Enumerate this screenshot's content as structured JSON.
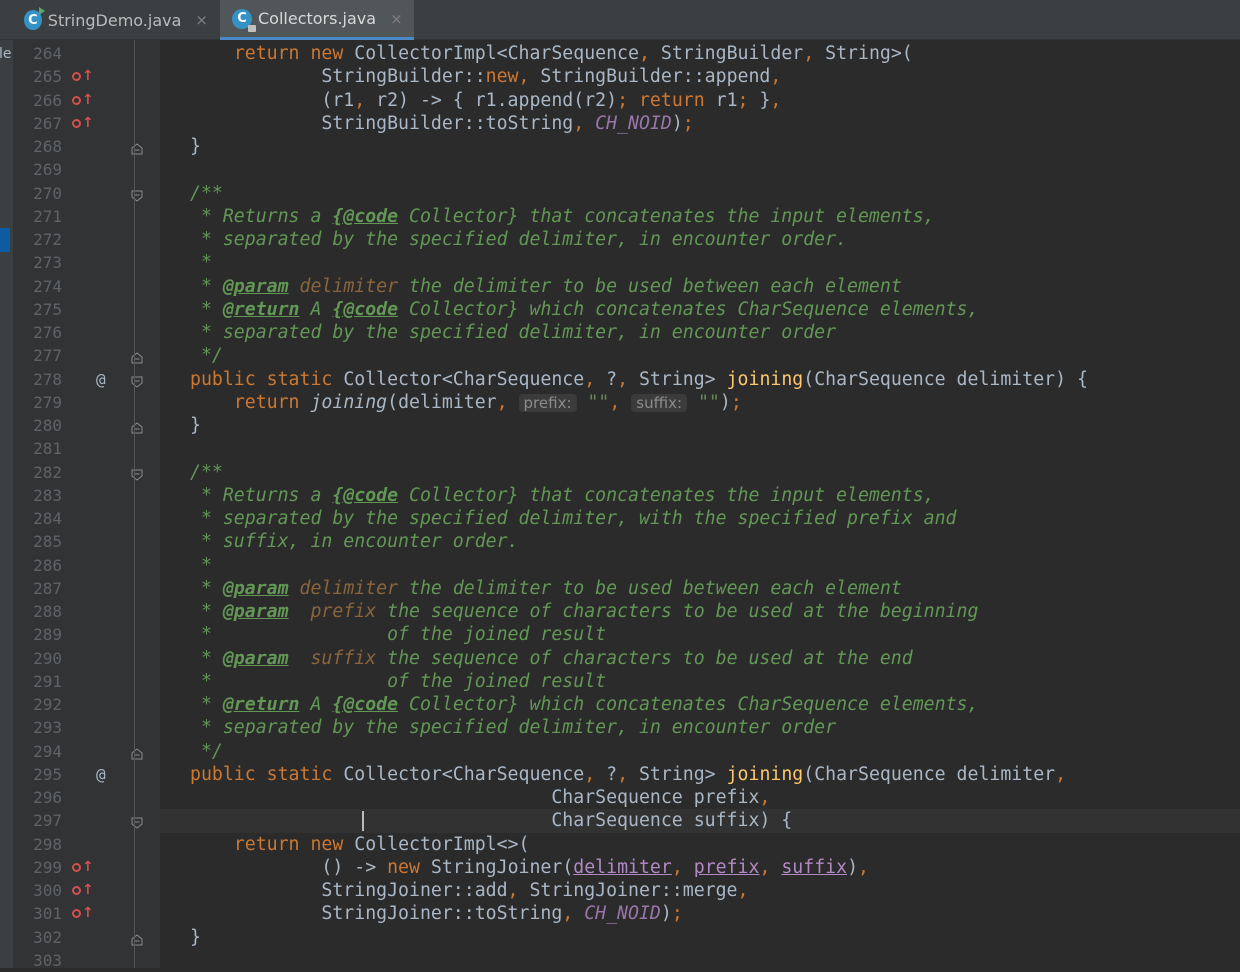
{
  "tabs": [
    {
      "label": "StringDemo.java",
      "icon_letter": "C"
    },
    {
      "label": "Collectors.java",
      "icon_letter": "C"
    }
  ],
  "side_strip_text": "le",
  "current_line": 297,
  "hints": {
    "prefix": "prefix:",
    "suffix": "suffix:"
  },
  "lines": [
    {
      "n": "264",
      "gutter": ""
    },
    {
      "n": "265",
      "gutter": "override"
    },
    {
      "n": "266",
      "gutter": "override"
    },
    {
      "n": "267",
      "gutter": "override"
    },
    {
      "n": "268",
      "gutter": "fold-end"
    },
    {
      "n": "269",
      "gutter": ""
    },
    {
      "n": "270",
      "gutter": "fold-start"
    },
    {
      "n": "271",
      "gutter": ""
    },
    {
      "n": "272",
      "gutter": ""
    },
    {
      "n": "273",
      "gutter": ""
    },
    {
      "n": "274",
      "gutter": ""
    },
    {
      "n": "275",
      "gutter": ""
    },
    {
      "n": "276",
      "gutter": ""
    },
    {
      "n": "277",
      "gutter": "fold-end"
    },
    {
      "n": "278",
      "gutter": "at-fold"
    },
    {
      "n": "279",
      "gutter": ""
    },
    {
      "n": "280",
      "gutter": "fold-end"
    },
    {
      "n": "281",
      "gutter": ""
    },
    {
      "n": "282",
      "gutter": "fold-start"
    },
    {
      "n": "283",
      "gutter": ""
    },
    {
      "n": "284",
      "gutter": ""
    },
    {
      "n": "285",
      "gutter": ""
    },
    {
      "n": "286",
      "gutter": ""
    },
    {
      "n": "287",
      "gutter": ""
    },
    {
      "n": "288",
      "gutter": ""
    },
    {
      "n": "289",
      "gutter": ""
    },
    {
      "n": "290",
      "gutter": ""
    },
    {
      "n": "291",
      "gutter": ""
    },
    {
      "n": "292",
      "gutter": ""
    },
    {
      "n": "293",
      "gutter": ""
    },
    {
      "n": "294",
      "gutter": "fold-end"
    },
    {
      "n": "295",
      "gutter": "at"
    },
    {
      "n": "296",
      "gutter": ""
    },
    {
      "n": "297",
      "gutter": "fold-start"
    },
    {
      "n": "298",
      "gutter": ""
    },
    {
      "n": "299",
      "gutter": "override"
    },
    {
      "n": "300",
      "gutter": "override"
    },
    {
      "n": "301",
      "gutter": "override"
    },
    {
      "n": "302",
      "gutter": "fold-end"
    },
    {
      "n": "303",
      "gutter": ""
    }
  ],
  "code": [
    [
      [
        "    ",
        ""
      ],
      [
        "return new ",
        "kw"
      ],
      [
        "CollectorImpl<CharSequence",
        ""
      ],
      [
        ", ",
        "kw"
      ],
      [
        "StringBuilder",
        ""
      ],
      [
        ", ",
        "kw"
      ],
      [
        "String>(",
        ""
      ]
    ],
    [
      [
        "            StringBuilder::",
        ""
      ],
      [
        "new",
        "kw"
      ],
      [
        ", ",
        "kw"
      ],
      [
        "StringBuilder::append",
        ""
      ],
      [
        ",",
        "kw"
      ]
    ],
    [
      [
        "            (r1",
        ""
      ],
      [
        ", ",
        "kw"
      ],
      [
        "r2) -> { r1.append(r2)",
        ""
      ],
      [
        "; ",
        "kw"
      ],
      [
        "return ",
        "kw"
      ],
      [
        "r1",
        ""
      ],
      [
        "; ",
        "kw"
      ],
      [
        "}",
        ""
      ],
      [
        ",",
        "kw"
      ]
    ],
    [
      [
        "            StringBuilder::toString",
        ""
      ],
      [
        ", ",
        "kw"
      ],
      [
        "CH_NOID",
        "cst"
      ],
      [
        ")",
        ""
      ],
      [
        ";",
        "kw"
      ]
    ],
    [
      [
        "}",
        ""
      ]
    ],
    [],
    [
      [
        "/**",
        "doc"
      ]
    ],
    [
      [
        " * Returns a ",
        "doc"
      ],
      [
        "{@code",
        "tag"
      ],
      [
        " Collector} that concatenates the input elements,",
        "doc"
      ]
    ],
    [
      [
        " * separated by the specified delimiter, in encounter order.",
        "doc"
      ]
    ],
    [
      [
        " *",
        "doc"
      ]
    ],
    [
      [
        " * ",
        "doc"
      ],
      [
        "@param",
        "tag"
      ],
      [
        " ",
        "doc"
      ],
      [
        "delimiter",
        "dparam"
      ],
      [
        " the delimiter to be used between each element",
        "doc"
      ]
    ],
    [
      [
        " * ",
        "doc"
      ],
      [
        "@return",
        "tag"
      ],
      [
        " A ",
        "doc"
      ],
      [
        "{@code",
        "tag"
      ],
      [
        " Collector} which concatenates CharSequence elements,",
        "doc"
      ]
    ],
    [
      [
        " * separated by the specified delimiter, in encounter order",
        "doc"
      ]
    ],
    [
      [
        " */",
        "doc"
      ]
    ],
    [
      [
        "public static ",
        "kw"
      ],
      [
        "Collector<CharSequence",
        ""
      ],
      [
        ", ",
        "kw"
      ],
      [
        "?",
        ""
      ],
      [
        ", ",
        "kw"
      ],
      [
        "String> ",
        ""
      ],
      [
        "joining",
        "fn"
      ],
      [
        "(CharSequence delimiter) {",
        ""
      ]
    ],
    [
      [
        "    ",
        ""
      ],
      [
        "return ",
        "kw"
      ],
      [
        "joining",
        "it"
      ],
      [
        "(delimiter",
        ""
      ],
      [
        ", ",
        "kw"
      ],
      [
        "HINT:prefix",
        "hint"
      ],
      [
        " ",
        ""
      ],
      [
        "\"\"",
        "str"
      ],
      [
        ", ",
        "kw"
      ],
      [
        "HINT:suffix",
        "hint"
      ],
      [
        " ",
        ""
      ],
      [
        "\"\"",
        "str"
      ],
      [
        ")",
        ""
      ],
      [
        ";",
        "kw"
      ]
    ],
    [
      [
        "}",
        ""
      ]
    ],
    [],
    [
      [
        "/**",
        "doc"
      ]
    ],
    [
      [
        " * Returns a ",
        "doc"
      ],
      [
        "{@code",
        "tag"
      ],
      [
        " Collector} that concatenates the input elements,",
        "doc"
      ]
    ],
    [
      [
        " * separated by the specified delimiter, with the specified prefix and",
        "doc"
      ]
    ],
    [
      [
        " * suffix, in encounter order.",
        "doc"
      ]
    ],
    [
      [
        " *",
        "doc"
      ]
    ],
    [
      [
        " * ",
        "doc"
      ],
      [
        "@param",
        "tag"
      ],
      [
        " ",
        "doc"
      ],
      [
        "delimiter",
        "dparam"
      ],
      [
        " the delimiter to be used between each element",
        "doc"
      ]
    ],
    [
      [
        " * ",
        "doc"
      ],
      [
        "@param",
        "tag"
      ],
      [
        "  ",
        "doc"
      ],
      [
        "prefix",
        "dparam"
      ],
      [
        " the sequence of characters to be used at the beginning",
        "doc"
      ]
    ],
    [
      [
        " *                of the joined result",
        "doc"
      ]
    ],
    [
      [
        " * ",
        "doc"
      ],
      [
        "@param",
        "tag"
      ],
      [
        "  ",
        "doc"
      ],
      [
        "suffix",
        "dparam"
      ],
      [
        " the sequence of characters to be used at the end",
        "doc"
      ]
    ],
    [
      [
        " *                of the joined result",
        "doc"
      ]
    ],
    [
      [
        " * ",
        "doc"
      ],
      [
        "@return",
        "tag"
      ],
      [
        " A ",
        "doc"
      ],
      [
        "{@code",
        "tag"
      ],
      [
        " Collector} which concatenates CharSequence elements,",
        "doc"
      ]
    ],
    [
      [
        " * separated by the specified delimiter, in encounter order",
        "doc"
      ]
    ],
    [
      [
        " */",
        "doc"
      ]
    ],
    [
      [
        "public static ",
        "kw"
      ],
      [
        "Collector<CharSequence",
        ""
      ],
      [
        ", ",
        "kw"
      ],
      [
        "?",
        ""
      ],
      [
        ", ",
        "kw"
      ],
      [
        "String> ",
        ""
      ],
      [
        "joining",
        "fn"
      ],
      [
        "(CharSequence delimiter",
        ""
      ],
      [
        ",",
        "kw"
      ]
    ],
    [
      [
        "                                 CharSequence prefix",
        ""
      ],
      [
        ",",
        "kw"
      ]
    ],
    [
      [
        "                                 CharSequence suffix) {",
        ""
      ]
    ],
    [
      [
        "    ",
        ""
      ],
      [
        "return new ",
        "kw"
      ],
      [
        "CollectorImpl<>(",
        ""
      ]
    ],
    [
      [
        "            () -> ",
        ""
      ],
      [
        "new ",
        "kw"
      ],
      [
        "StringJoiner(",
        ""
      ],
      [
        "delimiter",
        "param"
      ],
      [
        ", ",
        "kw"
      ],
      [
        "prefix",
        "param"
      ],
      [
        ", ",
        "kw"
      ],
      [
        "suffix",
        "param"
      ],
      [
        ")",
        ""
      ],
      [
        ",",
        "kw"
      ]
    ],
    [
      [
        "            StringJoiner::add",
        ""
      ],
      [
        ", ",
        "kw"
      ],
      [
        "StringJoiner::merge",
        ""
      ],
      [
        ",",
        "kw"
      ]
    ],
    [
      [
        "            StringJoiner::toString",
        ""
      ],
      [
        ", ",
        "kw"
      ],
      [
        "CH_NOID",
        "cst"
      ],
      [
        ")",
        ""
      ],
      [
        ";",
        "kw"
      ]
    ],
    [
      [
        "}",
        ""
      ]
    ],
    []
  ]
}
